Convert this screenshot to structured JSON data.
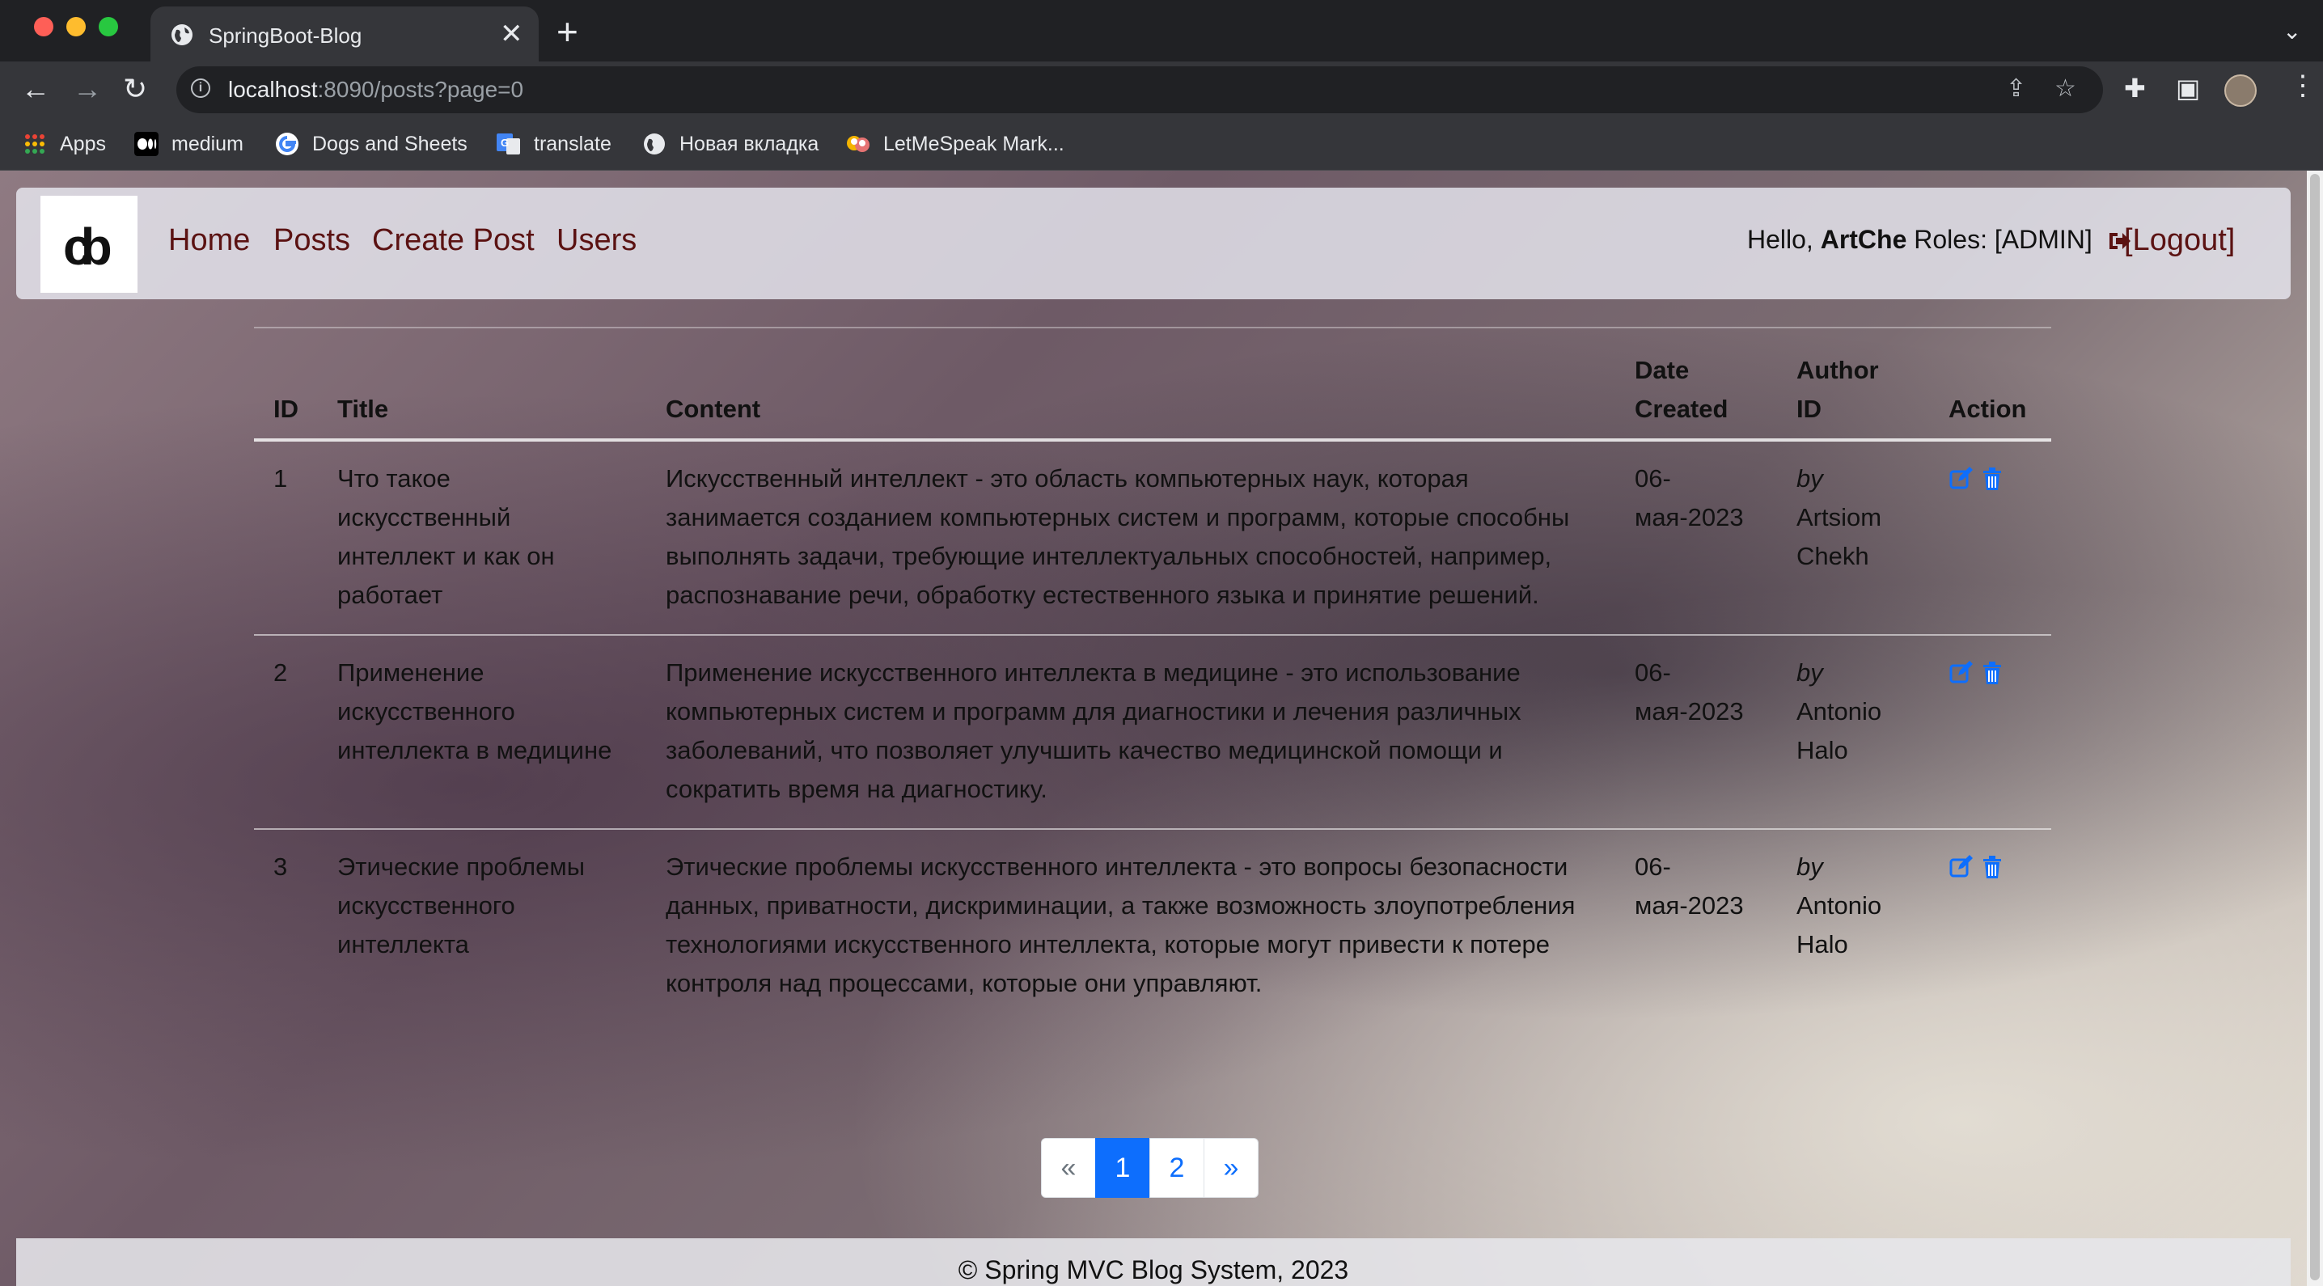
{
  "browser": {
    "tab_title": "SpringBoot-Blog",
    "tab_close": "✕",
    "new_tab": "+",
    "url_host": "localhost",
    "url_rest": ":8090/posts?page=0",
    "bookmarks": [
      {
        "label": "Apps",
        "icon": "apps-grid-icon",
        "color": "#ea4335"
      },
      {
        "label": "medium",
        "icon": "medium-icon",
        "color": "#000000"
      },
      {
        "label": "Dogs and Sheets",
        "icon": "google-icon",
        "color": "#4285f4"
      },
      {
        "label": "translate",
        "icon": "google-translate-icon",
        "color": "#4285f4"
      },
      {
        "label": "Новая вкладка",
        "icon": "globe-icon",
        "color": "#e8eaed"
      },
      {
        "label": "LetMeSpeak Mark...",
        "icon": "letmespeak-icon",
        "color": "#f4b400"
      }
    ]
  },
  "navbar": {
    "links": [
      "Home",
      "Posts",
      "Create Post",
      "Users"
    ],
    "hello_prefix": "Hello, ",
    "username": "ArtChe",
    "roles": " Roles: [ADMIN]",
    "logout": "[Logout]",
    "link_color": "#5b1212"
  },
  "table": {
    "headers": {
      "id": "ID",
      "title": "Title",
      "content": "Content",
      "date": "Date Created",
      "author": "Author ID",
      "action": "Action"
    },
    "rows": [
      {
        "id": "1",
        "title": "Что такое искусственный интеллект и как он работает",
        "content": "Искусственный интеллект - это область компьютерных наук, которая занимается созданием компьютерных систем и программ, которые способны выполнять задачи, требующие интеллектуальных способностей, например, распознавание речи, обработку естественного языка и принятие решений.",
        "date": "06-мая-2023",
        "by": "by",
        "author": "Artsiom Chekh"
      },
      {
        "id": "2",
        "title": "Применение искусственного интеллекта в медицине",
        "content": "Применение искусственного интеллекта в медицине - это использование компьютерных систем и программ для диагностики и лечения различных заболеваний, что позволяет улучшить качество медицинской помощи и сократить время на диагностику.",
        "date": "06-мая-2023",
        "by": "by",
        "author": "Antonio Halo"
      },
      {
        "id": "3",
        "title": "Этические проблемы искусственного интеллекта",
        "content": "Этические проблемы искусственного интеллекта - это вопросы безопасности данных, приватности, дискриминации, а также возможность злоупотребления технологиями искусственного интеллекта, которые могут привести к потере контроля над процессами, которые они управляют.",
        "date": "06-мая-2023",
        "by": "by",
        "author": "Antonio Halo"
      }
    ]
  },
  "pagination": {
    "prev": "«",
    "pages": [
      "1",
      "2"
    ],
    "current": "1",
    "next": "»",
    "accent": "#0d6efd"
  },
  "footer": {
    "text": "© Spring MVC Blog System, 2023"
  }
}
